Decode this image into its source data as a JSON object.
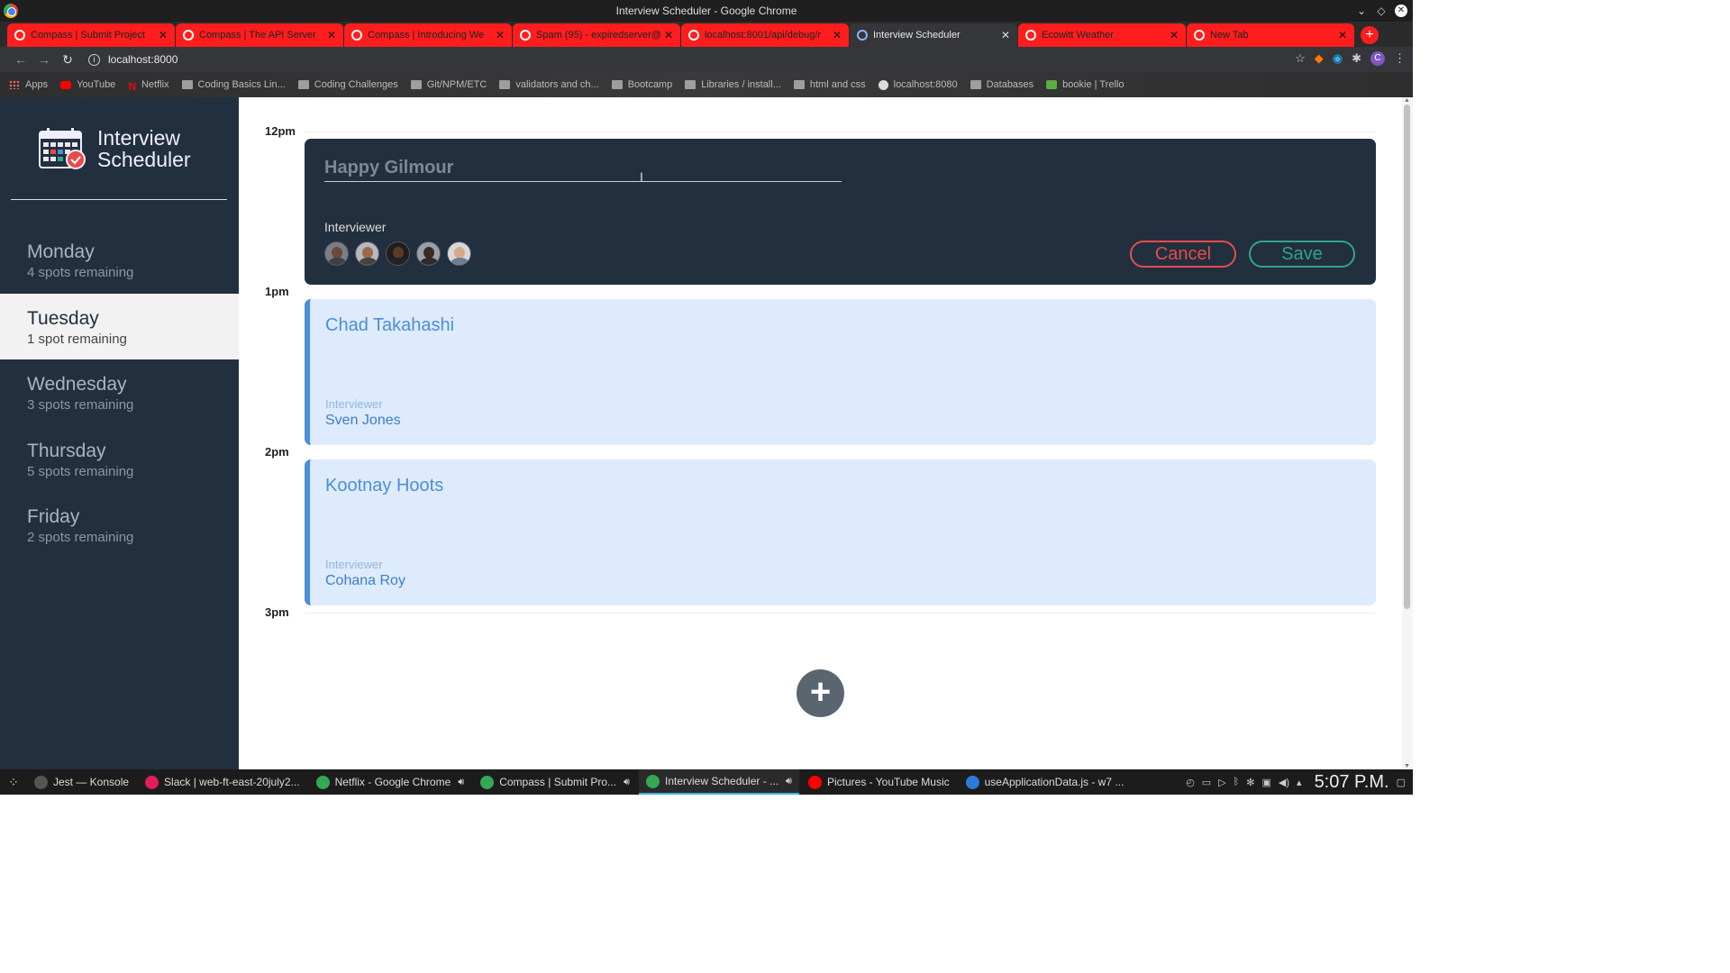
{
  "window": {
    "title": "Interview Scheduler - Google Chrome"
  },
  "tabs": [
    {
      "label": "Compass | Submit Project",
      "fav": "#ffffff"
    },
    {
      "label": "Compass | The API Server",
      "fav": "#ffffff"
    },
    {
      "label": "Compass | Introducing We",
      "fav": "#ffffff"
    },
    {
      "label": "Spam (95) - expiredserver@",
      "fav": "#ffffff"
    },
    {
      "label": "localhost:8001/api/debug/r",
      "fav": "#ffffff"
    },
    {
      "label": "Interview Scheduler",
      "fav": "#8ab4f8",
      "active": true
    },
    {
      "label": "Ecowitt Weather",
      "fav": "#ffffff"
    },
    {
      "label": "New Tab",
      "fav": "#ffffff"
    }
  ],
  "address": {
    "url": "localhost:8000"
  },
  "bookmarks": [
    {
      "label": "Apps",
      "icon": "apps"
    },
    {
      "label": "YouTube",
      "icon": "yt"
    },
    {
      "label": "Netflix",
      "icon": "nf"
    },
    {
      "label": "Coding Basics Lin...",
      "icon": "folder"
    },
    {
      "label": "Coding Challenges",
      "icon": "folder"
    },
    {
      "label": "Git/NPM/ETC",
      "icon": "folder"
    },
    {
      "label": "validators and ch...",
      "icon": "folder"
    },
    {
      "label": "Bootcamp",
      "icon": "folder"
    },
    {
      "label": "Libraries / install...",
      "icon": "folder"
    },
    {
      "label": "html and css",
      "icon": "folder"
    },
    {
      "label": "localhost:8080",
      "icon": "globe"
    },
    {
      "label": "Databases",
      "icon": "folder"
    },
    {
      "label": "bookie | Trello",
      "icon": "trello"
    }
  ],
  "sidebar": {
    "brand_line1": "Interview",
    "brand_line2": "Scheduler",
    "days": [
      {
        "name": "Monday",
        "spots": "4 spots remaining",
        "top": 0
      },
      {
        "name": "Tuesday",
        "spots": "1 spot remaining",
        "selected": true
      },
      {
        "name": "Wednesday",
        "spots": "3 spots remaining"
      },
      {
        "name": "Thursday",
        "spots": "5 spots remaining"
      },
      {
        "name": "Friday",
        "spots": "2 spots remaining"
      }
    ]
  },
  "schedule": {
    "times": [
      "12pm",
      "1pm",
      "2pm",
      "3pm"
    ],
    "form": {
      "placeholder": "Happy Gilmour",
      "interviewer_label": "Interviewer",
      "cancel_label": "Cancel",
      "save_label": "Save"
    },
    "appointments": [
      {
        "student": "Chad Takahashi",
        "interviewer_label": "Interviewer",
        "interviewer": "Sven Jones"
      },
      {
        "student": "Kootnay Hoots",
        "interviewer_label": "Interviewer",
        "interviewer": "Cohana Roy"
      }
    ]
  },
  "taskbar": {
    "items": [
      {
        "label": "Jest — Konsole",
        "icon": "#555555"
      },
      {
        "label": "Slack | web-ft-east-20july2...",
        "icon": "#e01e5a"
      },
      {
        "label": "Netflix - Google Chrome",
        "icon": "#34a853",
        "audio": true
      },
      {
        "label": "Compass | Submit Pro...",
        "icon": "#34a853",
        "audio": true
      },
      {
        "label": "Interview Scheduler - ...",
        "icon": "#34a853",
        "audio": true,
        "active": true
      },
      {
        "label": "Pictures - YouTube Music",
        "icon": "#ff0000"
      },
      {
        "label": "useApplicationData.js - w7 ...",
        "icon": "#2b7bd8"
      }
    ],
    "clock": "5:07 P.M."
  }
}
